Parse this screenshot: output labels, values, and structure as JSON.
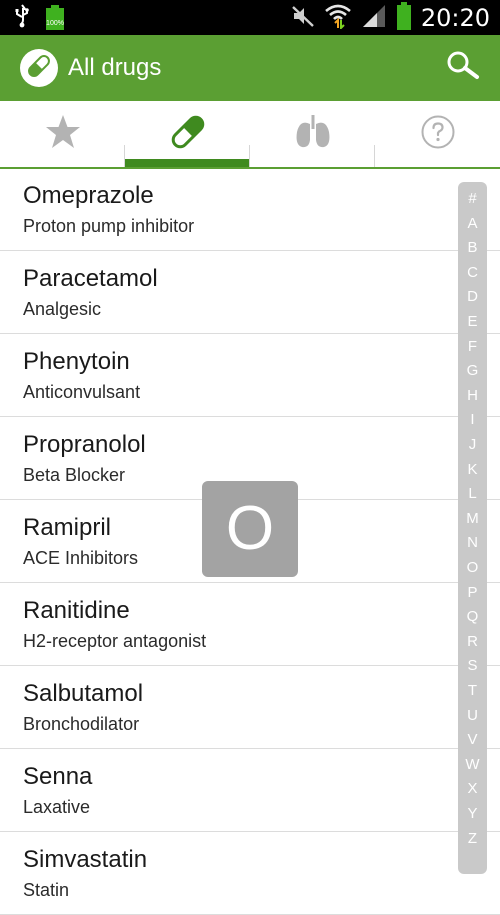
{
  "status_bar": {
    "time": "20:20",
    "battery_label": "100%"
  },
  "app_bar": {
    "title": "All drugs"
  },
  "tabs": [
    {
      "icon": "star-icon"
    },
    {
      "icon": "pill-icon",
      "selected": true
    },
    {
      "icon": "lungs-icon"
    },
    {
      "icon": "help-icon"
    }
  ],
  "drugs": [
    {
      "name": "Omeprazole",
      "category": "Proton pump inhibitor"
    },
    {
      "name": "Paracetamol",
      "category": "Analgesic"
    },
    {
      "name": "Phenytoin",
      "category": "Anticonvulsant"
    },
    {
      "name": "Propranolol",
      "category": "Beta Blocker"
    },
    {
      "name": "Ramipril",
      "category": "ACE Inhibitors"
    },
    {
      "name": "Ranitidine",
      "category": "H2-receptor antagonist"
    },
    {
      "name": "Salbutamol",
      "category": "Bronchodilator"
    },
    {
      "name": "Senna",
      "category": "Laxative"
    },
    {
      "name": "Simvastatin",
      "category": "Statin"
    }
  ],
  "index_letters": [
    "#",
    "A",
    "B",
    "C",
    "D",
    "E",
    "F",
    "G",
    "H",
    "I",
    "J",
    "K",
    "L",
    "M",
    "N",
    "O",
    "P",
    "Q",
    "R",
    "S",
    "T",
    "U",
    "V",
    "W",
    "X",
    "Y",
    "Z"
  ],
  "index_popup": {
    "letter": "O"
  },
  "colors": {
    "accent": "#5b9f33",
    "tab_indicator": "#3f8a1f"
  }
}
